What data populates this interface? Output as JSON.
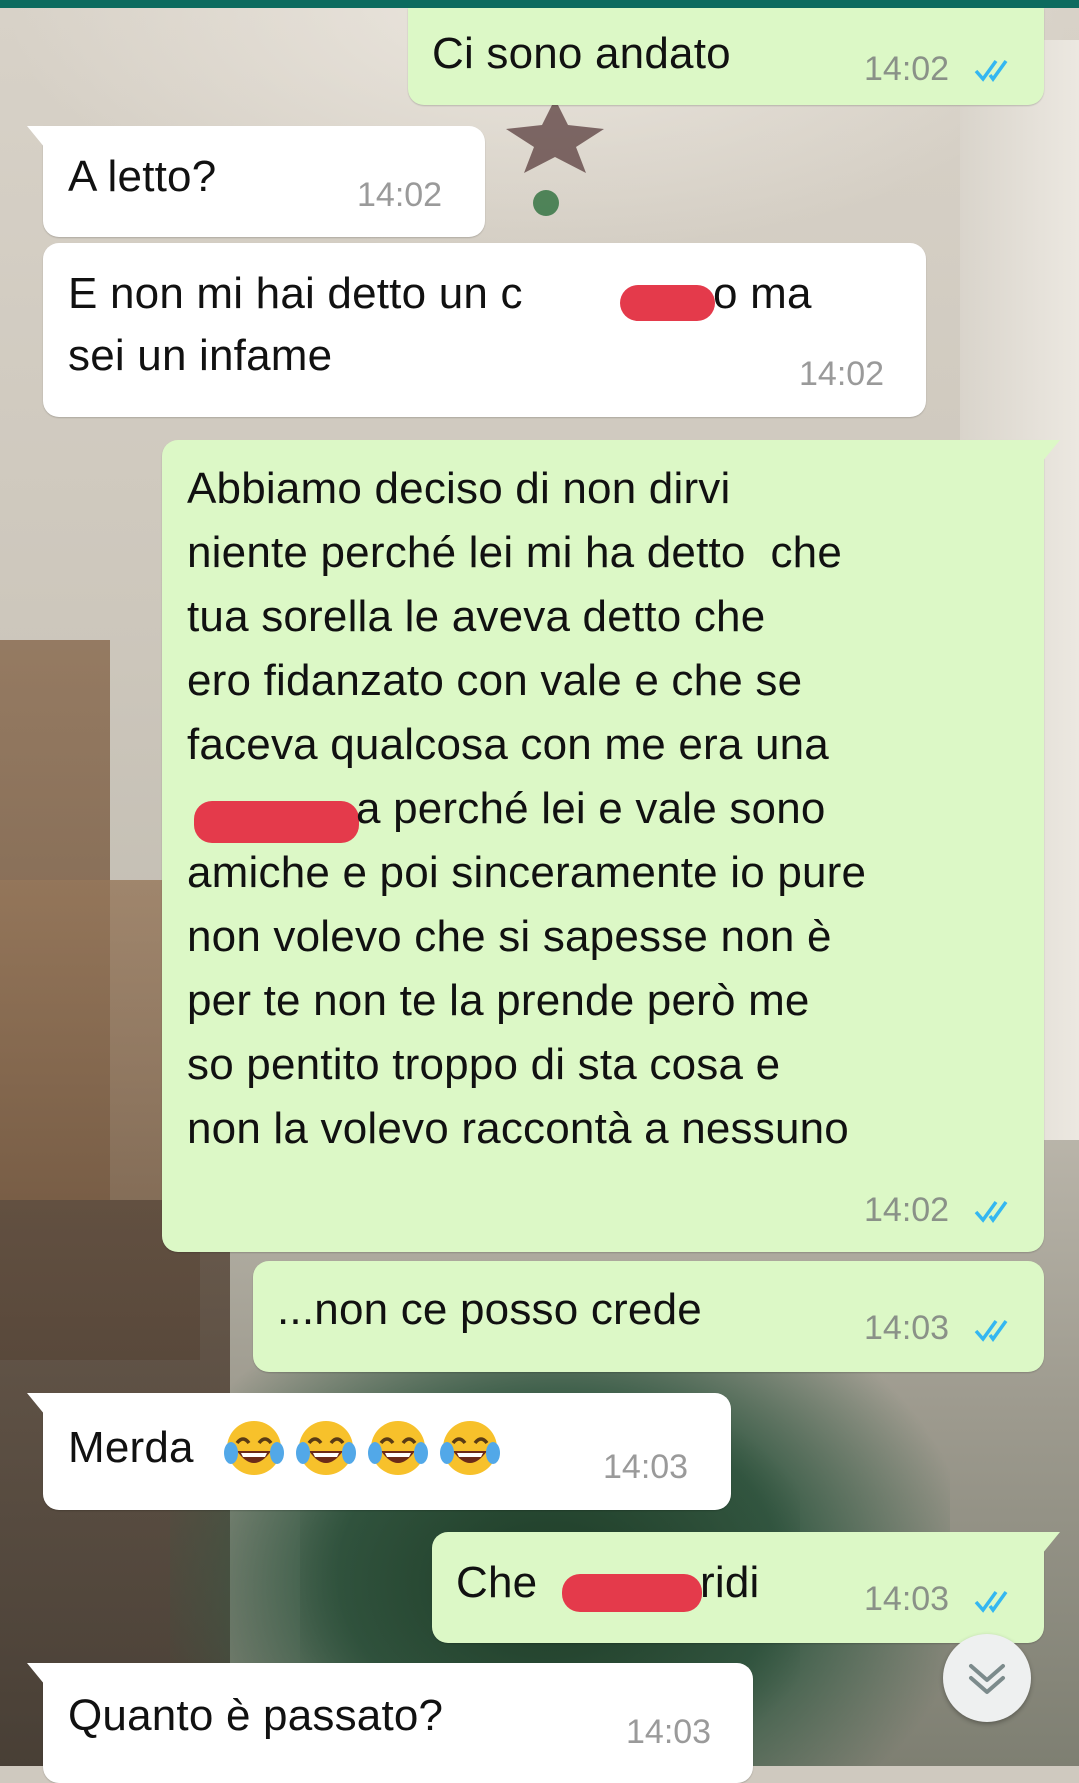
{
  "theme": {
    "outgoing_bubble": "#dcf8c6",
    "incoming_bubble": "#ffffff",
    "read_ticks": "#34b7f1",
    "redaction": "#e43a4b",
    "header_bar": "#0c6b5f"
  },
  "messages": [
    {
      "direction": "outgoing",
      "lines": [
        "Ci sono andato"
      ],
      "time": "14:02",
      "status": "read"
    },
    {
      "direction": "incoming",
      "lines": [
        "A letto?"
      ],
      "time": "14:02"
    },
    {
      "direction": "incoming",
      "lines": [
        "E non mi hai detto un c",
        "o ma",
        "sei un infame"
      ],
      "time": "14:02",
      "redacted": true
    },
    {
      "direction": "outgoing",
      "lines": [
        "Abbiamo deciso di non dirvi",
        "niente perché lei mi ha detto  che",
        "tua sorella le aveva detto che",
        "ero fidanzato con vale e che se",
        "faceva qualcosa con me era una",
        "a perché lei e vale sono",
        "amiche e poi sinceramente io pure",
        "non volevo che si sapesse non è",
        "per te non te la prende però me",
        "so pentito troppo di sta cosa e",
        "non la volevo raccontà a nessuno"
      ],
      "time": "14:02",
      "status": "read",
      "redacted": true
    },
    {
      "direction": "outgoing",
      "lines": [
        "...non ce posso crede"
      ],
      "time": "14:03",
      "status": "read"
    },
    {
      "direction": "incoming",
      "lines": [
        "Merda"
      ],
      "emoji": [
        "face-with-tears-of-joy",
        "face-with-tears-of-joy",
        "face-with-tears-of-joy",
        "face-with-tears-of-joy"
      ],
      "time": "14:03"
    },
    {
      "direction": "outgoing",
      "lines": [
        "Che",
        "ridi"
      ],
      "time": "14:03",
      "status": "read",
      "redacted": true
    },
    {
      "direction": "incoming",
      "lines": [
        "Quanto è passato?"
      ],
      "time": "14:03"
    }
  ],
  "scroll_button": {
    "icon": "double-chevron-down-icon"
  }
}
